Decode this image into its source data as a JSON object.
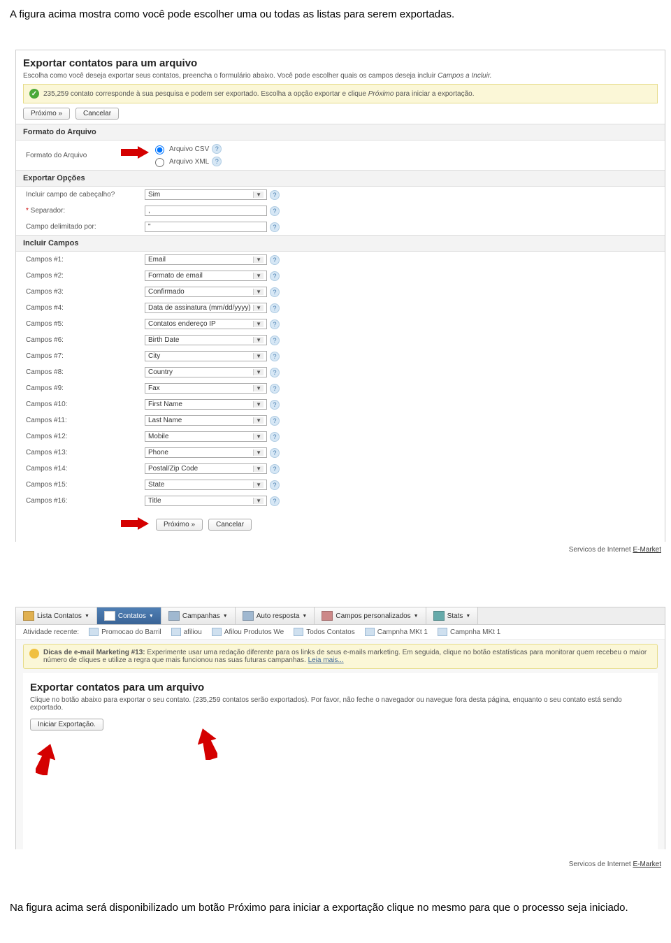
{
  "intro_text": "A figura acima mostra como você pode escolher uma ou todas as listas para serem exportadas.",
  "panel1": {
    "title": "Exportar contatos para um arquivo",
    "desc_before": "Escolha como você deseja exportar seus contatos, preencha o formulário abaixo. Você pode escolher quais os campos deseja incluir ",
    "desc_em": "Campos a Incluir.",
    "notice_before": "235,259 contato corresponde à sua pesquisa e podem ser exportado. Escolha a opção exportar e clique ",
    "notice_em": "Próximo",
    "notice_after": " para iniciar a exportação.",
    "btn_next": "Próximo »",
    "btn_cancel": "Cancelar",
    "section_format": "Formato do Arquivo",
    "row_format_label": "Formato do Arquivo",
    "opt_csv": "Arquivo CSV",
    "opt_xml": "Arquivo XML",
    "section_options": "Exportar Opções",
    "row_header_label": "Incluir campo de cabeçalho?",
    "row_header_value": "Sim",
    "row_sep_label": "Separador:",
    "row_sep_value": ",",
    "row_delim_label": "Campo delimitado por:",
    "row_delim_value": "\"",
    "section_fields": "Incluir Campos",
    "fields": [
      {
        "label": "Campos #1:",
        "value": "Email"
      },
      {
        "label": "Campos #2:",
        "value": "Formato de email"
      },
      {
        "label": "Campos #3:",
        "value": "Confirmado"
      },
      {
        "label": "Campos #4:",
        "value": "Data de assinatura (mm/dd/yyyy)"
      },
      {
        "label": "Campos #5:",
        "value": "Contatos endere&ccedil;o IP"
      },
      {
        "label": "Campos #6:",
        "value": "Birth Date"
      },
      {
        "label": "Campos #7:",
        "value": "City"
      },
      {
        "label": "Campos #8:",
        "value": "Country"
      },
      {
        "label": "Campos #9:",
        "value": "Fax"
      },
      {
        "label": "Campos #10:",
        "value": "First Name"
      },
      {
        "label": "Campos #11:",
        "value": "Last Name"
      },
      {
        "label": "Campos #12:",
        "value": "Mobile"
      },
      {
        "label": "Campos #13:",
        "value": "Phone"
      },
      {
        "label": "Campos #14:",
        "value": "Postal/Zip Code"
      },
      {
        "label": "Campos #15:",
        "value": "State"
      },
      {
        "label": "Campos #16:",
        "value": "Title"
      }
    ]
  },
  "footer_text": "Servicos de Internet ",
  "footer_link": "E-Market",
  "panel2": {
    "tabs": [
      {
        "label": "Lista Contatos",
        "icon": "#e0b050"
      },
      {
        "label": "Contatos",
        "icon": "#fff"
      },
      {
        "label": "Campanhas",
        "icon": "#a0b8d0"
      },
      {
        "label": "Auto resposta",
        "icon": "#a0b8d0"
      },
      {
        "label": "Campos personalizados",
        "icon": "#c88"
      },
      {
        "label": "Stats",
        "icon": "#6aa"
      }
    ],
    "recent_label": "Atividade recente:",
    "recent_items": [
      "Promocao do Barril",
      "afiliou",
      "Afilou Produtos We",
      "Todos Contatos",
      "Campnha MKt 1",
      "Campnha MKt 1"
    ],
    "tip_title": "Dicas de e-mail Marketing #13:",
    "tip_body": " Experimente usar uma redação diferente para os links de seus e-mails marketing. Em seguida, clique no botão estatísticas para monitorar quem recebeu o maior número de cliques e utilize a regra que mais funcionou nas suas futuras campanhas. ",
    "tip_link": "Leia mais...",
    "title": "Exportar contatos para um arquivo",
    "desc": "Clique no botão abaixo para exportar o seu contato. (235,259 contatos serão exportados). Por favor, não feche o navegador ou navegue fora desta página, enquanto o seu contato está sendo exportado.",
    "btn_start": "Iniciar Exportação."
  },
  "outro_text": "Na figura acima será disponibilizado um botão Próximo para iniciar a exportação clique no mesmo para que o processo seja iniciado."
}
